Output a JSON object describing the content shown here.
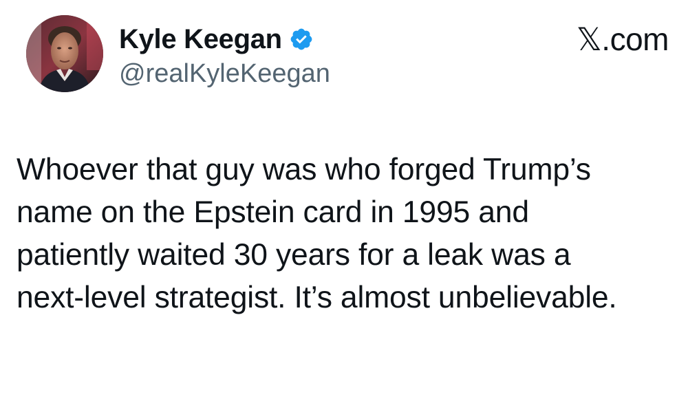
{
  "author": {
    "display_name": "Kyle Keegan",
    "handle": "@realKyleKeegan",
    "verified": true,
    "avatar_icon": "profile-photo",
    "verified_icon": "verified-badge-icon"
  },
  "brand": {
    "label": "𝕏.com"
  },
  "tweet": {
    "lines": [
      "Whoever that guy was who forged Trump’s",
      "name on the Epstein card in 1995 and",
      "patiently waited 30 years for a leak was a",
      "next-level strategist. It’s almost unbelievable."
    ]
  },
  "colors": {
    "text": "#0f1419",
    "secondary": "#536471",
    "verified_blue": "#1d9bf0",
    "background": "#ffffff"
  }
}
